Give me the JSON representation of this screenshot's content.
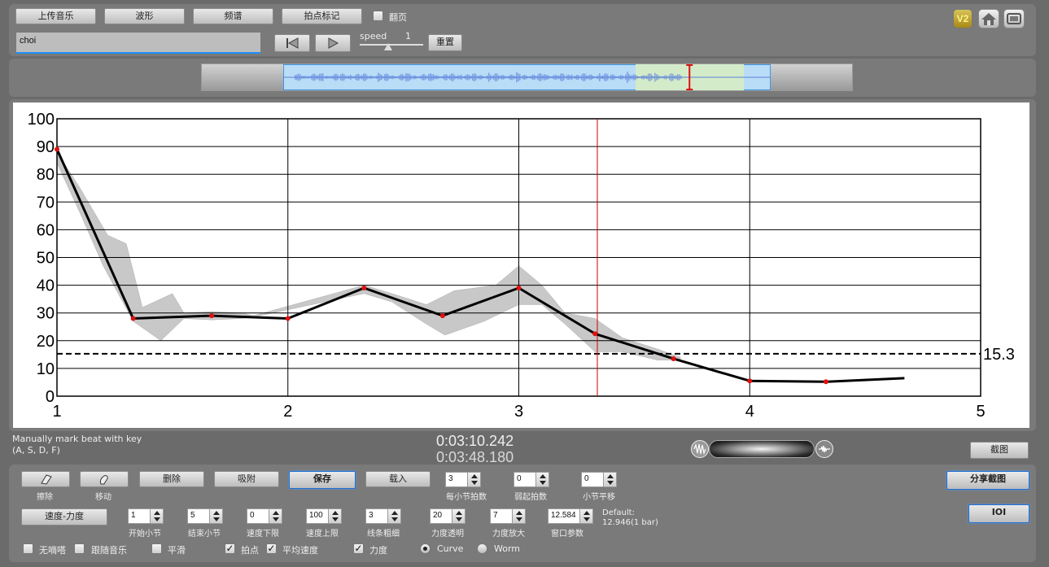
{
  "toolbar": {
    "upload_label": "上传音乐",
    "waveform_label": "波形",
    "spectrum_label": "频谱",
    "beat_mark_label": "拍点标记",
    "page_turn_label": "翻页",
    "song_name": "choi",
    "speed_label": "speed",
    "speed_value": "1",
    "reset_label": "重置",
    "version_label": "V2",
    "speed_slider_level": 0.45
  },
  "timeline": {
    "view_start_fraction": 0.125,
    "view_end_fraction": 0.875,
    "playhead_fraction": 0.75
  },
  "chart_data": {
    "type": "line",
    "xlim": [
      1,
      5
    ],
    "ylim": [
      0,
      100
    ],
    "x_ticks": [
      "1",
      "2",
      "3",
      "4",
      "5"
    ],
    "y_ticks": [
      "0",
      "10",
      "20",
      "30",
      "40",
      "50",
      "60",
      "70",
      "80",
      "90",
      "100"
    ],
    "threshold_value": 15.3,
    "threshold_label": "15.3",
    "cursor_x": 3.34,
    "series": [
      {
        "points": [
          [
            1.0,
            89
          ],
          [
            1.33,
            28
          ],
          [
            1.67,
            29
          ],
          [
            2.0,
            28
          ],
          [
            2.33,
            39
          ],
          [
            2.67,
            29
          ],
          [
            3.0,
            39
          ],
          [
            3.33,
            22.5
          ],
          [
            3.67,
            13.5
          ],
          [
            4.0,
            5.5
          ],
          [
            4.33,
            5.2
          ],
          [
            4.67,
            6.5
          ]
        ]
      }
    ],
    "band_upper": [
      [
        1.0,
        88
      ],
      [
        1.1,
        75
      ],
      [
        1.22,
        58
      ],
      [
        1.3,
        55
      ],
      [
        1.37,
        32
      ],
      [
        1.5,
        37
      ],
      [
        1.55,
        30
      ],
      [
        1.67,
        30.5
      ],
      [
        1.8,
        30
      ],
      [
        1.85,
        29
      ],
      [
        2.33,
        40
      ],
      [
        2.45,
        37
      ],
      [
        2.6,
        33
      ],
      [
        2.72,
        38
      ],
      [
        2.9,
        40
      ],
      [
        3.0,
        47
      ],
      [
        3.1,
        40
      ],
      [
        3.2,
        30
      ],
      [
        3.33,
        28
      ],
      [
        3.45,
        21
      ],
      [
        3.6,
        17
      ],
      [
        3.7,
        14
      ]
    ],
    "band_lower": [
      [
        1.0,
        84
      ],
      [
        1.1,
        66
      ],
      [
        1.2,
        47
      ],
      [
        1.33,
        27
      ],
      [
        1.45,
        20
      ],
      [
        1.55,
        28
      ],
      [
        1.67,
        27.5
      ],
      [
        1.8,
        28
      ],
      [
        1.85,
        28.5
      ],
      [
        2.33,
        37
      ],
      [
        2.45,
        34
      ],
      [
        2.6,
        26
      ],
      [
        2.68,
        22
      ],
      [
        2.85,
        27
      ],
      [
        3.0,
        33
      ],
      [
        3.1,
        33
      ],
      [
        3.2,
        26
      ],
      [
        3.33,
        16
      ],
      [
        3.45,
        16
      ],
      [
        3.6,
        13
      ],
      [
        3.7,
        13
      ]
    ]
  },
  "status": {
    "hint_line1": "Manually mark beat with key",
    "hint_line2": "(A, S, D, F)",
    "current_time": "0:03:10.242",
    "total_time": "0:03:48.180",
    "screenshot_label": "截图"
  },
  "controls": {
    "erase_label": "擦除",
    "move_label": "移动",
    "delete_label": "删除",
    "snap_label": "吸附",
    "save_label": "保存",
    "load_label": "载入",
    "beats_per_bar": {
      "value": "3",
      "label": "每小节拍数"
    },
    "pickup_beats": {
      "value": "0",
      "label": "弱起拍数"
    },
    "bar_shift": {
      "value": "0",
      "label": "小节平移"
    },
    "share_label": "分享截图",
    "mode_select": "速度-力度",
    "start_bar": {
      "value": "1",
      "label": "开始小节"
    },
    "end_bar": {
      "value": "5",
      "label": "结束小节"
    },
    "tempo_min": {
      "value": "0",
      "label": "速度下限"
    },
    "tempo_max": {
      "value": "100",
      "label": "速度上限"
    },
    "line_width": {
      "value": "3",
      "label": "线条粗细"
    },
    "dyn_opacity": {
      "value": "20",
      "label": "力度透明"
    },
    "dyn_scale": {
      "value": "7",
      "label": "力度放大"
    },
    "window_param": {
      "value": "12.584",
      "label": "窗口参数"
    },
    "default_line1": "Default:",
    "default_line2": "12.946(1 bar)",
    "ioi_label": "IOI",
    "no_click_label": "无嘀嗒",
    "follow_music_label": "跟随音乐",
    "smooth_label": "平滑",
    "beat_point_label": "拍点",
    "avg_tempo_label": "平均速度",
    "dynamics_label": "力度",
    "curve_label": "Curve",
    "worm_label": "Worm"
  }
}
